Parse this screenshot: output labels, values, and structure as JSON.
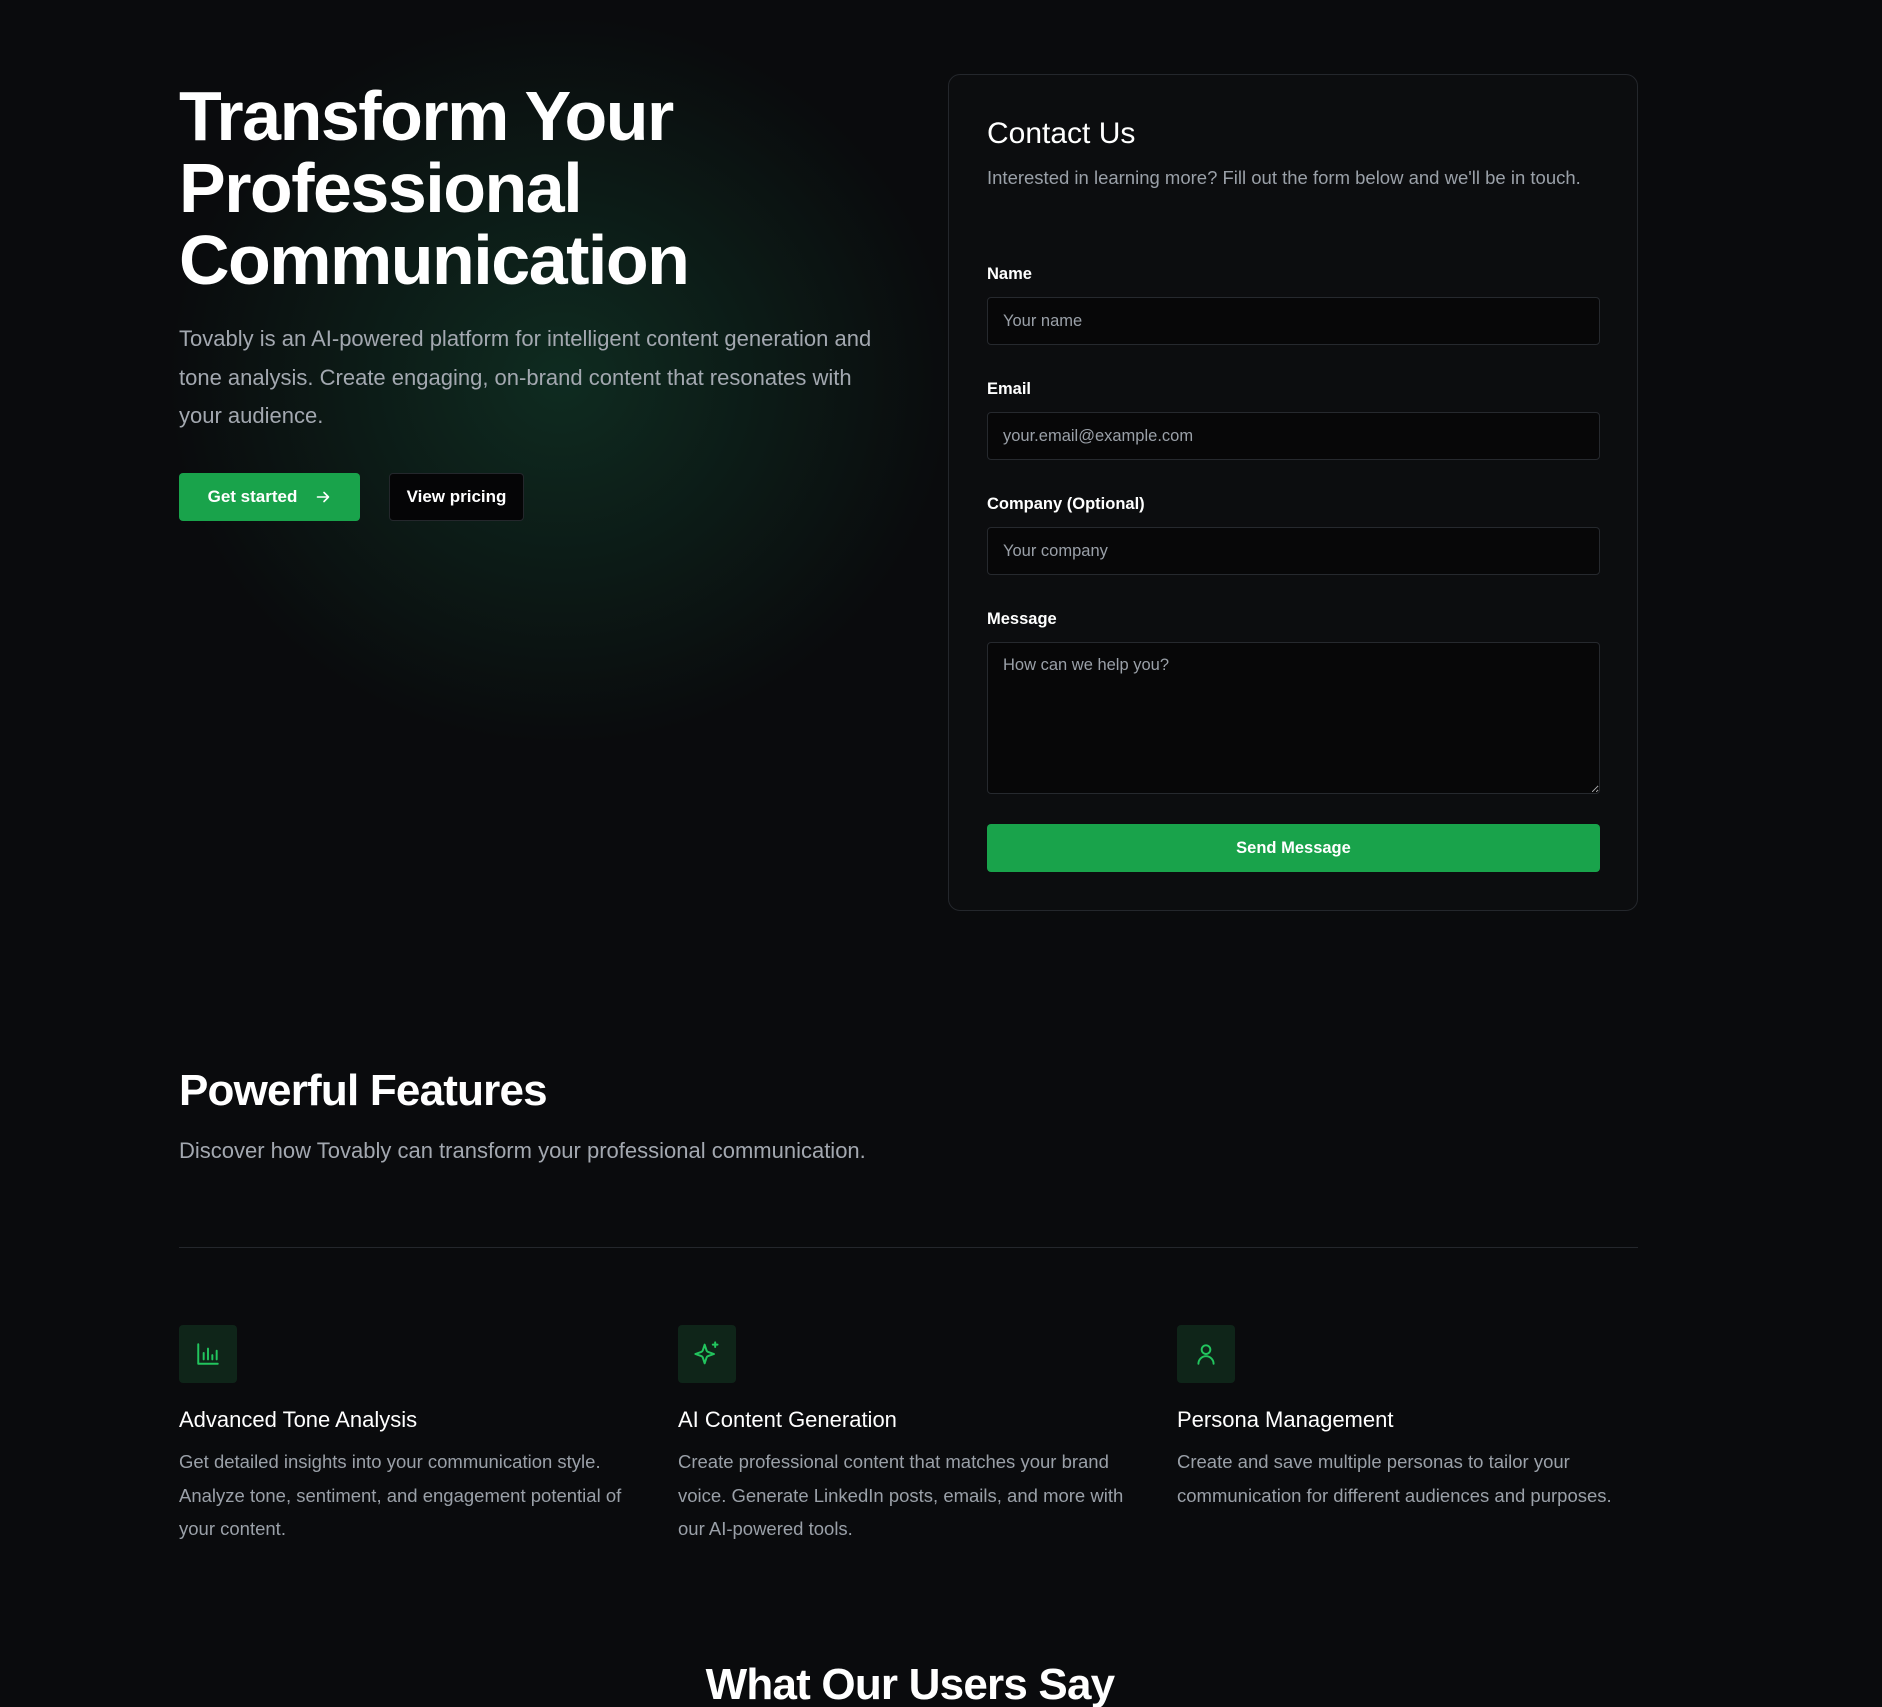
{
  "hero": {
    "title_lines": [
      "Transform Your",
      "Professional",
      "Communication"
    ],
    "description": "Tovably is an AI-powered platform for intelligent content generation and tone analysis. Create engaging, on-brand content that resonates with your audience.",
    "primary_button": {
      "label": "Get started",
      "icon": "arrow-right-icon"
    },
    "secondary_button": {
      "label": "View pricing"
    }
  },
  "contact": {
    "title": "Contact Us",
    "description": "Interested in learning more? Fill out the form below and we'll be in touch.",
    "fields": {
      "name": {
        "label": "Name",
        "placeholder": "Your name",
        "value": ""
      },
      "email": {
        "label": "Email",
        "placeholder": "your.email@example.com",
        "value": ""
      },
      "company": {
        "label": "Company (Optional)",
        "placeholder": "Your company",
        "value": ""
      },
      "message": {
        "label": "Message",
        "placeholder": "How can we help you?",
        "value": ""
      }
    },
    "submit_label": "Send Message"
  },
  "features": {
    "title": "Powerful Features",
    "subtitle": "Discover how Tovably can transform your professional communication.",
    "items": [
      {
        "icon": "bar-chart-icon",
        "title": "Advanced Tone Analysis",
        "description": "Get detailed insights into your communication style. Analyze tone, sentiment, and engagement potential of your content."
      },
      {
        "icon": "sparkles-icon",
        "title": "AI Content Generation",
        "description": "Create professional content that matches your brand voice. Generate LinkedIn posts, emails, and more with our AI-powered tools."
      },
      {
        "icon": "user-icon",
        "title": "Persona Management",
        "description": "Create and save multiple personas to tailor your communication for different audiences and purposes."
      }
    ]
  },
  "testimonials": {
    "title": "What Our Users Say"
  },
  "colors": {
    "background": "#0a0b0d",
    "accent": "#19a34b",
    "icon_green": "#22c55e",
    "muted_text": "#9aa0a8"
  }
}
